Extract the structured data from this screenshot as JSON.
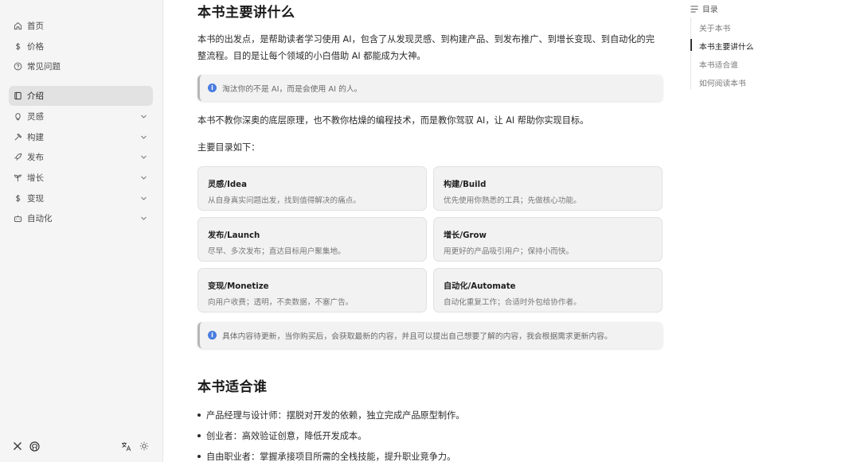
{
  "sidebar": {
    "top_items": [
      {
        "label": "首页",
        "icon": "home-icon"
      },
      {
        "label": "价格",
        "icon": "dollar-icon"
      },
      {
        "label": "常见问题",
        "icon": "help-icon"
      }
    ],
    "sections": [
      {
        "label": "介绍",
        "icon": "book-icon",
        "active": true
      },
      {
        "label": "灵感",
        "icon": "lightbulb-icon"
      },
      {
        "label": "构建",
        "icon": "hammer-icon"
      },
      {
        "label": "发布",
        "icon": "rocket-icon"
      },
      {
        "label": "增长",
        "icon": "sprout-icon"
      },
      {
        "label": "变现",
        "icon": "dollar-icon"
      },
      {
        "label": "自动化",
        "icon": "bot-icon"
      }
    ],
    "footer_icons": [
      "x-icon",
      "github-icon",
      "translate-icon",
      "sun-icon"
    ]
  },
  "main": {
    "section1": {
      "heading": "本书主要讲什么",
      "intro": "本书的出发点，是帮助读者学习使用 AI，包含了从发现灵感、到构建产品、到发布推广、到增长变现、到自动化的完整流程。目的是让每个领域的小白借助 AI 都能成为大神。",
      "callout": "淘汰你的不是 AI，而是会使用 AI 的人。",
      "para2": "本书不教你深奥的底层原理，也不教你枯燥的编程技术，而是教你驾驭 AI，让 AI 帮助你实现目标。",
      "toc_intro": "主要目录如下：",
      "cards": [
        {
          "title": "灵感/Idea",
          "desc": "从自身真实问题出发，找到值得解决的痛点。"
        },
        {
          "title": "构建/Build",
          "desc": "优先使用你熟悉的工具；先做核心功能。"
        },
        {
          "title": "发布/Launch",
          "desc": "尽早、多次发布；直达目标用户聚集地。"
        },
        {
          "title": "增长/Grow",
          "desc": "用更好的产品吸引用户；保持小而快。"
        },
        {
          "title": "变现/Monetize",
          "desc": "向用户收费；透明，不卖数据，不塞广告。"
        },
        {
          "title": "自动化/Automate",
          "desc": "自动化重复工作；合适时外包给协作者。"
        }
      ],
      "callout2": "具体内容待更新，当你购买后，会获取最新的内容，并且可以提出自己想要了解的内容，我会根据需求更新内容。"
    },
    "section2": {
      "heading": "本书适合谁",
      "bullets": [
        "产品经理与设计师：摆脱对开发的依赖，独立完成产品原型制作。",
        "创业者：高效验证创意，降低开发成本。",
        "自由职业者：掌握承接项目所需的全栈技能，提升职业竞争力。"
      ]
    }
  },
  "toc": {
    "title": "目录",
    "items": [
      "关于本书",
      "本书主要讲什么",
      "本书适合谁",
      "如何阅读本书"
    ],
    "active_index": 1
  },
  "colors": {
    "accent_info": "#4a7de0",
    "active_bg": "#e2e2e2",
    "sidebar_bg": "#f5f5f5"
  }
}
